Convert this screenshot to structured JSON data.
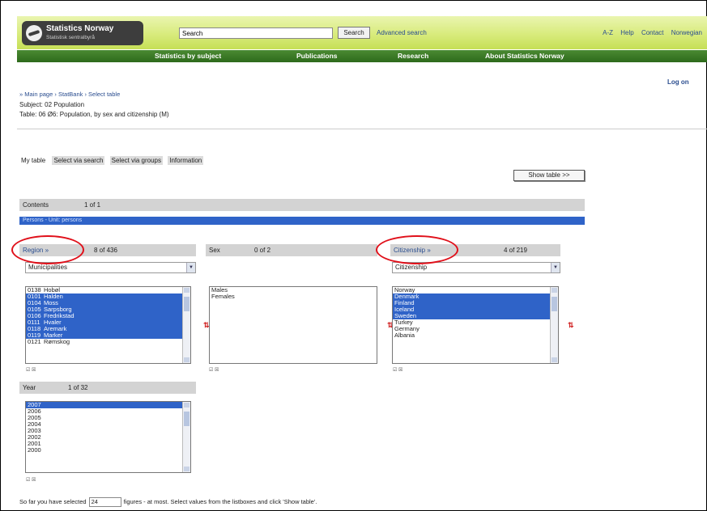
{
  "header": {
    "logo_name": "Statistics Norway",
    "logo_sub": "Statistisk sentralbyrå",
    "search_placeholder": "Search",
    "search_button": "Search",
    "advanced_search": "Advanced search",
    "links": [
      "A-Z",
      "Help",
      "Contact",
      "Norwegian"
    ]
  },
  "nav": [
    "Statistics by subject",
    "Publications",
    "Research",
    "About Statistics Norway"
  ],
  "login": "Log on",
  "breadcrumb": "» Main page › StatBank › Select table",
  "subject": "Subject: 02 Population",
  "table": "Table:    06 Ø6: Population, by sex and citizenship (M)",
  "tabs": [
    "My table",
    "Select via search",
    "Select via groups",
    "Information"
  ],
  "show_table": "Show table >>",
  "contents": {
    "label": "Contents",
    "count": "1  of 1",
    "item": "Persons - Unit: persons"
  },
  "region": {
    "label": "Region »",
    "count": "8  of 436",
    "dropdown": "Municipalities",
    "items": [
      {
        "code": "0138",
        "name": "Hobøl",
        "selected": false
      },
      {
        "code": "0101",
        "name": "Halden",
        "selected": true
      },
      {
        "code": "0104",
        "name": "Moss",
        "selected": true
      },
      {
        "code": "0105",
        "name": "Sarpsborg",
        "selected": true
      },
      {
        "code": "0106",
        "name": "Fredrikstad",
        "selected": true
      },
      {
        "code": "0111",
        "name": "Hvaler",
        "selected": true
      },
      {
        "code": "0118",
        "name": "Aremark",
        "selected": true
      },
      {
        "code": "0119",
        "name": "Marker",
        "selected": true
      },
      {
        "code": "0121",
        "name": "Rømskog",
        "selected": false
      }
    ]
  },
  "sex": {
    "label": "Sex",
    "count": "0  of 2",
    "items": [
      {
        "name": "Males",
        "selected": false
      },
      {
        "name": "Females",
        "selected": false
      }
    ]
  },
  "citizenship": {
    "label": "Citizenship »",
    "count": "4  of 219",
    "dropdown": "Citizenship",
    "items": [
      {
        "name": "Norway",
        "selected": false
      },
      {
        "name": "Denmark",
        "selected": true
      },
      {
        "name": "Finland",
        "selected": true
      },
      {
        "name": "Iceland",
        "selected": true
      },
      {
        "name": "Sweden",
        "selected": true
      },
      {
        "name": "Turkey",
        "selected": false
      },
      {
        "name": "Germany",
        "selected": false
      },
      {
        "name": "Albania",
        "selected": false
      }
    ]
  },
  "year": {
    "label": "Year",
    "count": "1 of 32",
    "items": [
      {
        "name": "2007",
        "selected": true
      },
      {
        "name": "2006",
        "selected": false
      },
      {
        "name": "2005",
        "selected": false
      },
      {
        "name": "2004",
        "selected": false
      },
      {
        "name": "2003",
        "selected": false
      },
      {
        "name": "2002",
        "selected": false
      },
      {
        "name": "2001",
        "selected": false
      },
      {
        "name": "2000",
        "selected": false
      }
    ]
  },
  "footer": {
    "prefix": "So far you have selected",
    "count": "24",
    "suffix": "figures - at most. Select values from the listboxes and click 'Show table'."
  }
}
